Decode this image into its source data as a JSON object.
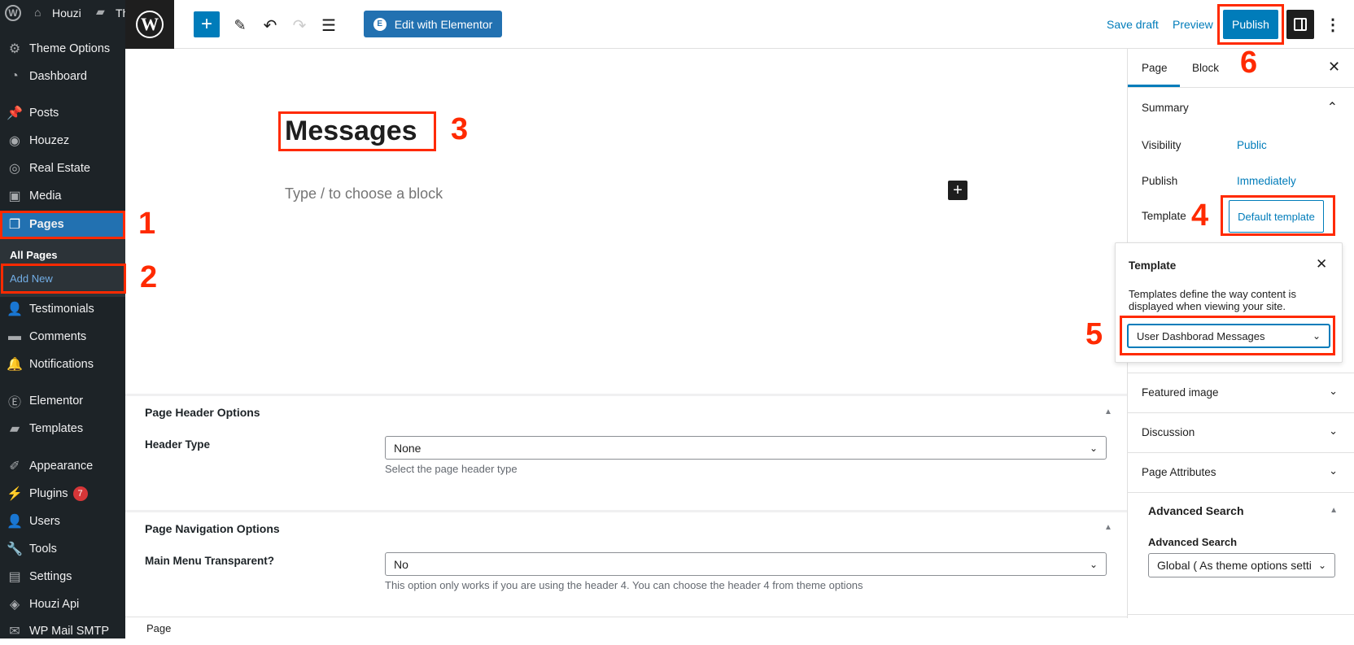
{
  "admin_bar": {
    "site_name": "Houzi",
    "truncated": "Th"
  },
  "admin_menu": {
    "items": [
      {
        "label": "Theme Options",
        "icon": "gear-icon"
      },
      {
        "label": "Dashboard",
        "icon": "dashboard-icon"
      },
      {
        "label": "Posts",
        "icon": "pin-icon"
      },
      {
        "label": "Houzez",
        "icon": "circle-icon"
      },
      {
        "label": "Real Estate",
        "icon": "location-icon"
      },
      {
        "label": "Media",
        "icon": "media-icon"
      },
      {
        "label": "Pages",
        "icon": "pages-icon",
        "active": true
      },
      {
        "label": "Testimonials",
        "icon": "user-icon"
      },
      {
        "label": "Comments",
        "icon": "comment-icon"
      },
      {
        "label": "Notifications",
        "icon": "bell-icon"
      },
      {
        "label": "Elementor",
        "icon": "elementor-icon"
      },
      {
        "label": "Templates",
        "icon": "folder-icon"
      },
      {
        "label": "Appearance",
        "icon": "brush-icon"
      },
      {
        "label": "Plugins",
        "icon": "plug-icon",
        "badge": "7"
      },
      {
        "label": "Users",
        "icon": "user-icon"
      },
      {
        "label": "Tools",
        "icon": "wrench-icon"
      },
      {
        "label": "Settings",
        "icon": "settings-icon"
      },
      {
        "label": "Houzi Api",
        "icon": "api-icon"
      },
      {
        "label": "WP Mail SMTP",
        "icon": "mail-icon"
      }
    ],
    "submenu": {
      "all_pages": "All Pages",
      "add_new": "Add New"
    }
  },
  "toolbar": {
    "edit_elementor": "Edit with Elementor",
    "save_draft": "Save draft",
    "preview": "Preview",
    "publish": "Publish"
  },
  "editor": {
    "title": "Messages",
    "placeholder": "Type / to choose a block"
  },
  "annotations": [
    "1",
    "2",
    "3",
    "4",
    "5",
    "6"
  ],
  "meta_boxes": [
    {
      "title": "Page Header Options",
      "field_label": "Header Type",
      "value": "None",
      "help": "Select the page header type"
    },
    {
      "title": "Page Navigation Options",
      "field_label": "Main Menu Transparent?",
      "value": "No",
      "help": "This option only works if you are using the header 4. You can choose the header 4 from theme options"
    }
  ],
  "footer": {
    "breadcrumb": "Page"
  },
  "settings_sidebar": {
    "tabs": [
      "Page",
      "Block"
    ],
    "summary": {
      "title": "Summary",
      "visibility_label": "Visibility",
      "visibility_value": "Public",
      "publish_label": "Publish",
      "publish_value": "Immediately",
      "template_label": "Template",
      "template_value": "Default template"
    },
    "template_popover": {
      "title": "Template",
      "description": "Templates define the way content is displayed when viewing your site.",
      "selected": "User Dashborad Messages"
    },
    "panels": [
      "Featured image",
      "Discussion",
      "Page Attributes"
    ],
    "advanced_search": {
      "title": "Advanced Search",
      "label": "Advanced Search",
      "value": "Global ( As theme options setti"
    }
  },
  "colors": {
    "accent": "#007cba",
    "admin_bg": "#1d2327",
    "annotation": "#ff2a00"
  }
}
